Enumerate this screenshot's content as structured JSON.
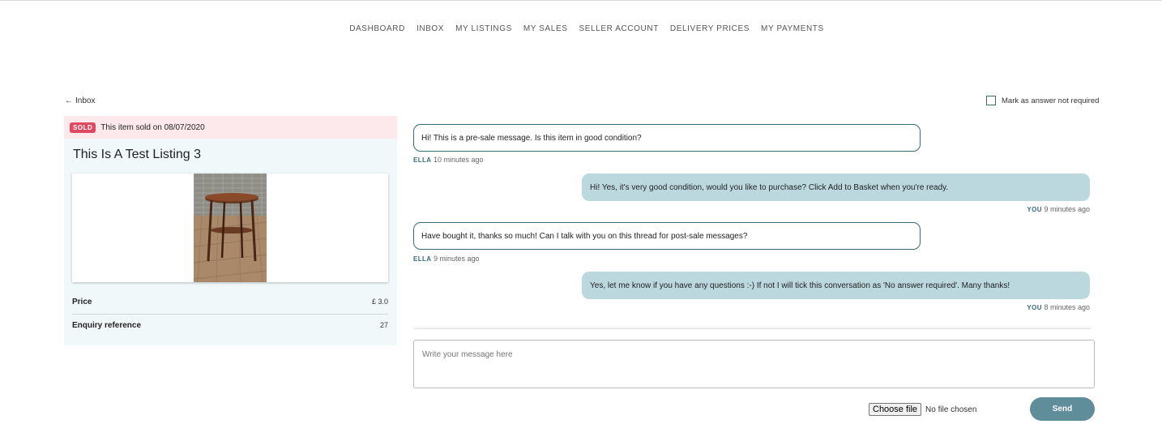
{
  "nav": {
    "items": [
      "DASHBOARD",
      "INBOX",
      "MY LISTINGS",
      "MY SALES",
      "SELLER ACCOUNT",
      "DELIVERY PRICES",
      "MY PAYMENTS"
    ]
  },
  "back": {
    "arrow": "←",
    "label": "Inbox"
  },
  "mark_answer": {
    "label": "Mark as answer not required",
    "checked": false
  },
  "listing": {
    "sold_badge": "SOLD",
    "sold_text": "This item sold on 08/07/2020",
    "title": "This Is A Test Listing 3",
    "price_label": "Price",
    "price_value": "£ 3.0",
    "reference_label": "Enquiry reference",
    "reference_value": "27"
  },
  "messages": [
    {
      "sender": "other",
      "text": "Hi! This is a pre-sale message. Is this item in good condition?",
      "who": "ELLA",
      "time": "10 minutes ago"
    },
    {
      "sender": "me",
      "text": "Hi! Yes, it's very good condition, would you like to purchase? Click Add to Basket when you're ready.",
      "who": "YOU",
      "time": "9 minutes ago"
    },
    {
      "sender": "other",
      "text": "Have bought it, thanks so much! Can I talk with you on this thread for post-sale messages?",
      "who": "ELLA",
      "time": "9 minutes ago"
    },
    {
      "sender": "me",
      "text": "Yes, let me know if you have any questions :-) If not I will tick this conversation as 'No answer required'. Many thanks!",
      "who": "YOU",
      "time": "8 minutes ago"
    }
  ],
  "compose": {
    "placeholder": "Write your message here"
  },
  "file": {
    "button_label": "Choose file",
    "status": "No file chosen"
  },
  "send_label": "Send",
  "colors": {
    "accent": "#5f8d99",
    "bubble_mine": "#bcd8df",
    "sold_badge": "#e04862",
    "sold_bar": "#fde8ec",
    "panel": "#f0f8fa"
  }
}
